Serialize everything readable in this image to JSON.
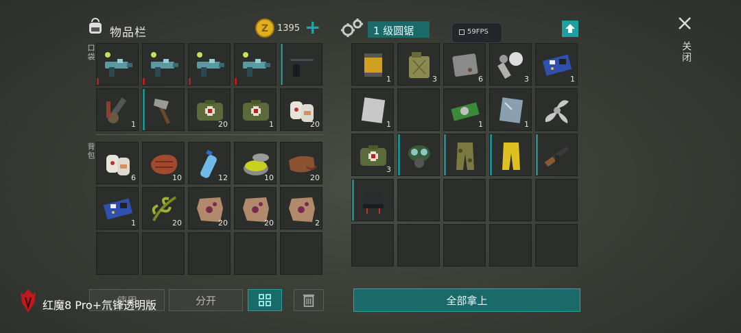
{
  "left_panel": {
    "title": "物品栏",
    "coins": "1395",
    "add_symbol": "+",
    "pocket_label": "口袋",
    "backpack_label": "背包",
    "pocket_slots": [
      {
        "icon": "plasma-gun-icon",
        "count": ""
      },
      {
        "icon": "plasma-gun-icon",
        "count": ""
      },
      {
        "icon": "plasma-gun-icon",
        "count": ""
      },
      {
        "icon": "plasma-gun-icon",
        "count": ""
      },
      {
        "icon": "pistol-icon",
        "count": ""
      },
      {
        "icon": "toolkit-icon",
        "count": "1"
      },
      {
        "icon": "hatchet-icon",
        "count": ""
      },
      {
        "icon": "medkit-icon",
        "count": "20"
      },
      {
        "icon": "medkit-icon",
        "count": "1"
      },
      {
        "icon": "bandage-icon",
        "count": "20"
      }
    ],
    "backpack_slots": [
      {
        "icon": "bandage-icon",
        "count": "6"
      },
      {
        "icon": "steak-icon",
        "count": "10"
      },
      {
        "icon": "water-bottle-icon",
        "count": "12"
      },
      {
        "icon": "ointment-jar-icon",
        "count": "10"
      },
      {
        "icon": "leather-icon",
        "count": "20"
      },
      {
        "icon": "circuit-board-icon",
        "count": "1"
      },
      {
        "icon": "herb-icon",
        "count": "20"
      },
      {
        "icon": "hide-icon",
        "count": "20"
      },
      {
        "icon": "hide-icon",
        "count": "20"
      },
      {
        "icon": "hide-icon",
        "count": "2"
      },
      {
        "icon": "",
        "count": ""
      },
      {
        "icon": "",
        "count": ""
      },
      {
        "icon": "",
        "count": ""
      },
      {
        "icon": "",
        "count": ""
      },
      {
        "icon": "",
        "count": ""
      }
    ],
    "use_button": "使用",
    "split_button": "分开"
  },
  "right_panel": {
    "title": "1 级圆锯",
    "fps": "59FPS",
    "slots": [
      {
        "icon": "oil-filter-icon",
        "count": "1"
      },
      {
        "icon": "jerrycan-icon",
        "count": "3"
      },
      {
        "icon": "metal-plate-icon",
        "count": "6"
      },
      {
        "icon": "gear-parts-icon",
        "count": "3"
      },
      {
        "icon": "circuit-board-icon",
        "count": "1"
      },
      {
        "icon": "steel-sheet-icon",
        "count": "1"
      },
      {
        "icon": "",
        "count": ""
      },
      {
        "icon": "chip-board-icon",
        "count": "1"
      },
      {
        "icon": "glass-plate-icon",
        "count": "1"
      },
      {
        "icon": "propeller-icon",
        "count": ""
      },
      {
        "icon": "medkit-icon",
        "count": "3"
      },
      {
        "icon": "gas-mask-icon",
        "count": ""
      },
      {
        "icon": "camo-pants-icon",
        "count": ""
      },
      {
        "icon": "yellow-pants-icon",
        "count": ""
      },
      {
        "icon": "rifle-icon",
        "count": ""
      },
      {
        "icon": "helmet-icon",
        "count": ""
      },
      {
        "icon": "",
        "count": ""
      },
      {
        "icon": "",
        "count": ""
      },
      {
        "icon": "",
        "count": ""
      },
      {
        "icon": "",
        "count": ""
      },
      {
        "icon": "",
        "count": ""
      },
      {
        "icon": "",
        "count": ""
      },
      {
        "icon": "",
        "count": ""
      },
      {
        "icon": "",
        "count": ""
      },
      {
        "icon": "",
        "count": ""
      }
    ],
    "take_all_button": "全部拿上"
  },
  "close_label": "关闭",
  "watermark": "红魔8 Pro+氘锋透明版",
  "colors": {
    "accent": "#1f8a8a",
    "coin": "#e0b020",
    "teal_text": "#8fe8e8"
  }
}
